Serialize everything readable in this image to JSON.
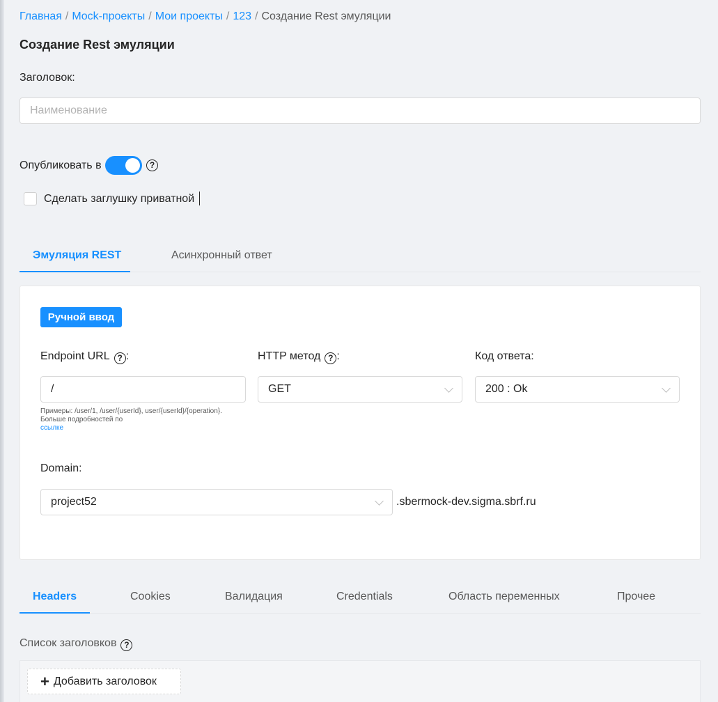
{
  "breadcrumb": {
    "items": [
      "Главная",
      "Mock-проекты",
      "Мои проекты",
      "123"
    ],
    "current": "Создание Rest эмуляции",
    "separator": "/"
  },
  "page": {
    "title": "Создание Rest эмуляции"
  },
  "form": {
    "title_label": "Заголовок:",
    "title_placeholder": "Наименование",
    "title_value": "",
    "publish_label": "Опубликовать в",
    "publish_enabled": true,
    "private_label": "Сделать заглушку приватной",
    "private_checked": false
  },
  "main_tabs": [
    {
      "label": "Эмуляция REST",
      "active": true
    },
    {
      "label": "Асинхронный ответ",
      "active": false
    }
  ],
  "rest": {
    "manual_input_label": "Ручной ввод",
    "endpoint_label": "Endpoint URL",
    "endpoint_value": "/",
    "endpoint_hint": "Примеры: /user/1, /user/{userId}, user/{userId}/{operation}. Больше подробностей по",
    "endpoint_hint_link": "ссылке",
    "method_label": "HTTP метод",
    "method_value": "GET",
    "code_label": "Код ответа:",
    "code_value": "200 : Ok",
    "domain_label": "Domain:",
    "domain_value": "project52",
    "domain_suffix": ".sbermock-dev.sigma.sbrf.ru",
    "colon": ":"
  },
  "sub_tabs": [
    {
      "label": "Headers",
      "active": true
    },
    {
      "label": "Cookies",
      "active": false
    },
    {
      "label": "Валидация",
      "active": false
    },
    {
      "label": "Credentials",
      "active": false
    },
    {
      "label": "Область переменных",
      "active": false
    },
    {
      "label": "Прочее",
      "active": false
    }
  ],
  "headers": {
    "list_label": "Список заголовков",
    "add_label": "Добавить заголовок"
  },
  "icons": {
    "help": "?",
    "plus": "+"
  },
  "colors": {
    "accent": "#1890ff",
    "background": "#f0f2f5",
    "card": "#ffffff"
  }
}
